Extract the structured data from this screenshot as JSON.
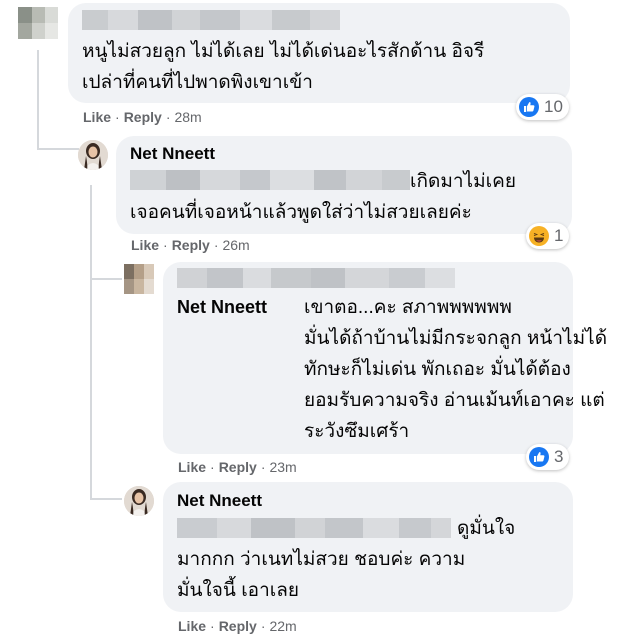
{
  "comments": [
    {
      "name": "",
      "text": "หนูไม่สวยลูก ไม่ได้เลย ไม่ได้เด่นอะไรสักด้าน อิจรี\nเปล่าที่คนที่ไปพาดพิงเขาเข้า",
      "actions": {
        "like": "Like",
        "reply": "Reply",
        "time": "28m"
      },
      "reaction": {
        "icon": "like-icon",
        "count": "10"
      }
    },
    {
      "name": "Net Nneett",
      "text_line1": "เกิดมาไม่เคย",
      "text_line2": "เจอคนที่เจอหน้าแล้วพูดใส่ว่าไม่สวยเลยค่ะ",
      "actions": {
        "like": "Like",
        "reply": "Reply",
        "time": "26m"
      },
      "reaction": {
        "icon": "haha-icon",
        "count": "1"
      }
    },
    {
      "name": "",
      "tag": "Net Nneett",
      "text": "เขาตอ...คะ สภาพพพพพพ\nมั่นได้ถ้าบ้านไม่มีกระจกลูก หน้าไม่ได้\nทักษะก็ไม่เด่น พักเถอะ มั่นได้ต้อง\nยอมรับความจริง อ่านเม้นท์เอาคะ แต่\nระวังซึมเศร้า",
      "actions": {
        "like": "Like",
        "reply": "Reply",
        "time": "23m"
      },
      "reaction": {
        "icon": "like-icon",
        "count": "3"
      }
    },
    {
      "name": "Net Nneett",
      "text_line1": "ดูมั่นใจ",
      "text_rest": "มากกก ว่าเนทไม่สวย ชอบค่ะ ความ\nมั่นใจนี้ เอาเลย",
      "actions": {
        "like": "Like",
        "reply": "Reply",
        "time": "22m"
      }
    }
  ],
  "colors": {
    "bubble": "#f0f2f5",
    "meta": "#65676b",
    "like_blue": "#1877f2",
    "haha_yellow": "#f7b125"
  }
}
